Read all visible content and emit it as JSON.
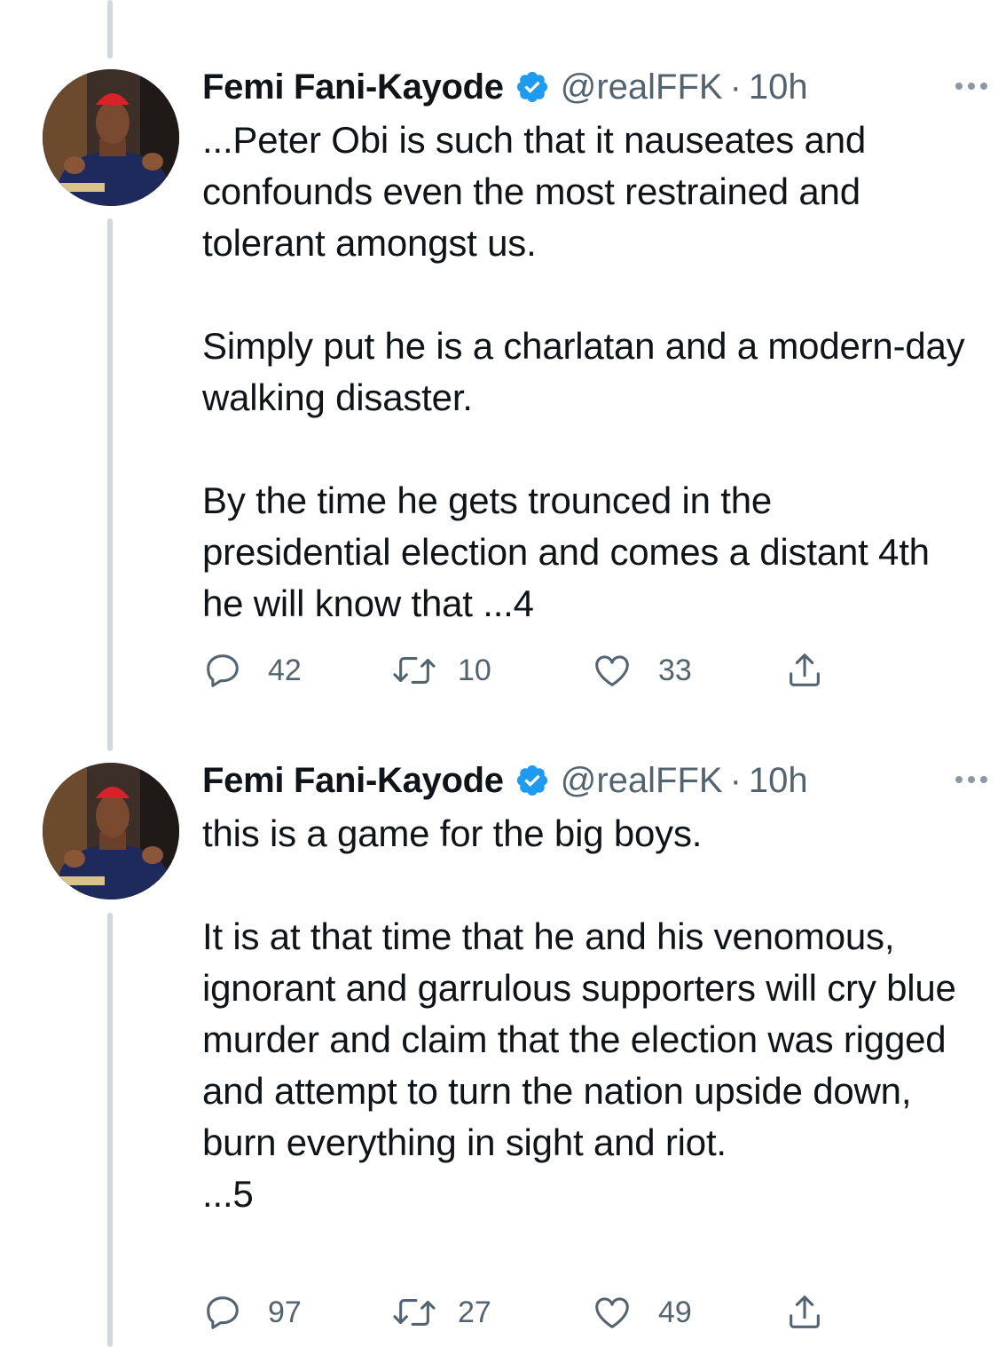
{
  "tweets": [
    {
      "name": "Femi Fani-Kayode",
      "handle": "@realFFK",
      "separator": "·",
      "time": "10h",
      "paragraphs": [
        "...Peter Obi is such that it nauseates and confounds even the most restrained and tolerant amongst us.",
        "Simply put he is a charlatan and a modern-day walking disaster.",
        "By the time he gets trounced in the presidential election and comes a distant 4th he will know that ...4"
      ],
      "replies": "42",
      "retweets": "10",
      "likes": "33"
    },
    {
      "name": "Femi Fani-Kayode",
      "handle": "@realFFK",
      "separator": "·",
      "time": "10h",
      "paragraphs": [
        "this is a game for the big boys.",
        "It is at that time that he and his venomous, ignorant and garrulous supporters will cry blue murder and claim that the election was rigged and attempt to turn the nation upside down, burn everything in sight and riot.\n...5"
      ],
      "replies": "97",
      "retweets": "27",
      "likes": "49"
    }
  ],
  "colors": {
    "text": "#0f1419",
    "secondary": "#536471",
    "verified": "#1d9bf0",
    "thread_line": "#cfd9de"
  },
  "icons": [
    "verified-badge-icon",
    "more-icon",
    "reply-icon",
    "retweet-icon",
    "like-icon",
    "share-icon"
  ]
}
